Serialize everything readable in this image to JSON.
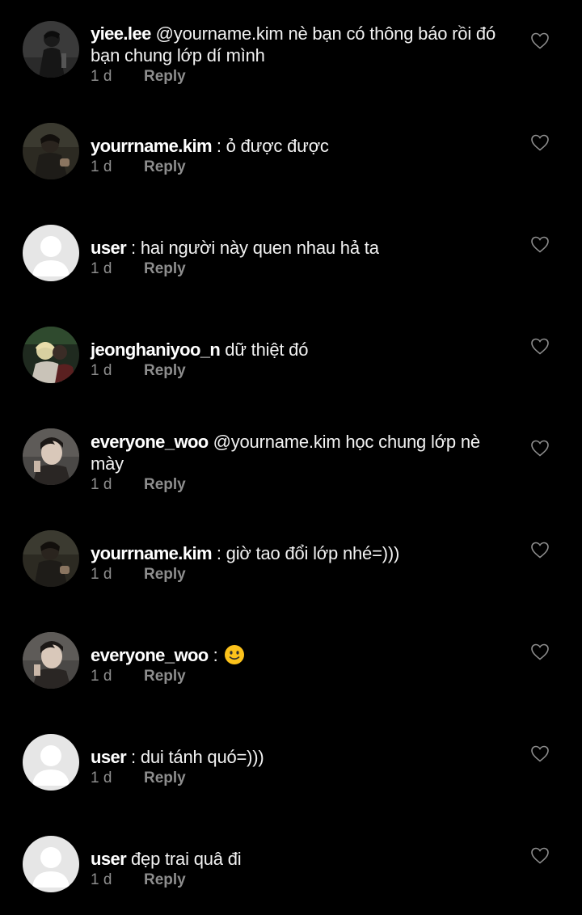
{
  "comments": [
    {
      "username": "yiee.lee",
      "text": "@yourname.kim nè bạn có thông báo rồi đó bạn chung lớp dí mình",
      "time": "1 d",
      "reply": "Reply",
      "avatar": "photo-dark"
    },
    {
      "username": "yourrname.kim",
      "text": ": ỏ được được",
      "time": "1 d",
      "reply": "Reply",
      "avatar": "photo-boy"
    },
    {
      "username": "user",
      "text": ": hai người này quen nhau hả ta",
      "time": "1 d",
      "reply": "Reply",
      "avatar": "default-user-icon"
    },
    {
      "username": "jeonghaniyoo_n",
      "text": "dữ thiệt đó",
      "time": "1 d",
      "reply": "Reply",
      "avatar": "photo-blond"
    },
    {
      "username": "everyone_woo",
      "text": "@yourname.kim học chung lớp nè mày",
      "time": "1 d",
      "reply": "Reply",
      "avatar": "photo-man"
    },
    {
      "username": "yourrname.kim",
      "text": ": giờ tao đổi lớp nhé=)))",
      "time": "1 d",
      "reply": "Reply",
      "avatar": "photo-boy"
    },
    {
      "username": "everyone_woo",
      "text": ":",
      "time": "1 d",
      "reply": "Reply",
      "avatar": "photo-man",
      "emoji": "slightly-smiling-face-emoji"
    },
    {
      "username": "user",
      "text": ": dui tánh quó=)))",
      "time": "1 d",
      "reply": "Reply",
      "avatar": "default-user-icon"
    },
    {
      "username": "user",
      "text": "đẹp trai quâ đi",
      "time": "1 d",
      "reply": "Reply",
      "avatar": "default-user-icon"
    }
  ],
  "colors": {
    "background": "#000000",
    "text": "#f2f2f2",
    "secondary": "#8e8e8e",
    "heart_outline": "#8e8e8e",
    "default_avatar_bg": "#e6e6e6",
    "emoji": "#fcc21b"
  }
}
